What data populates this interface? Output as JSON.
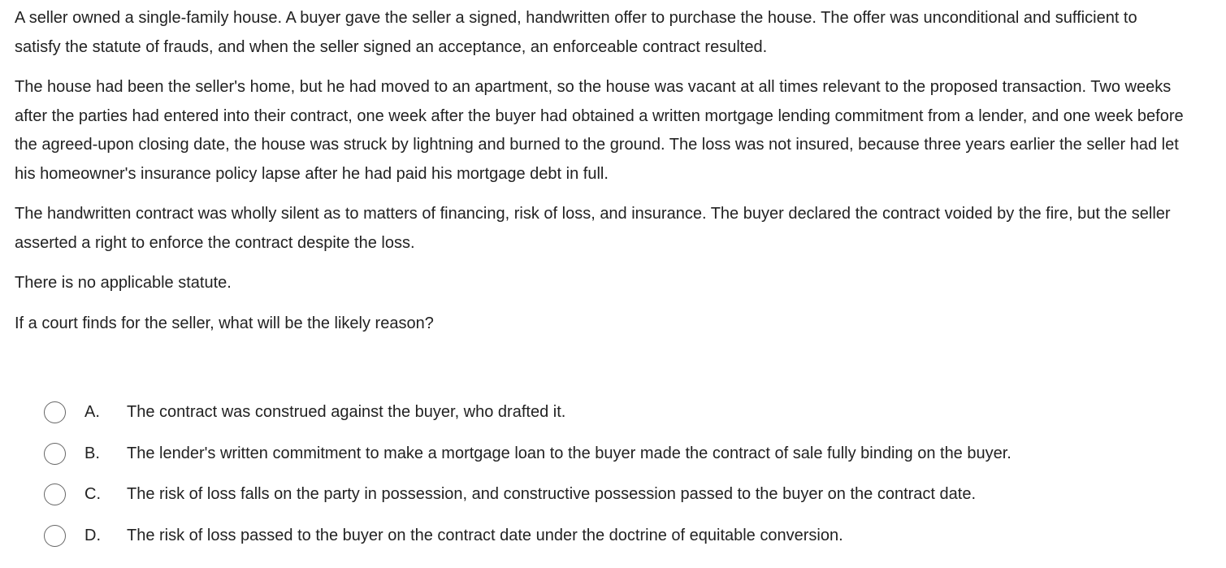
{
  "question": {
    "paragraphs": [
      "A seller owned a single-family house.  A buyer gave the seller a signed, handwritten offer to purchase the house.  The offer was unconditional and sufficient to satisfy the statute of frauds, and when the seller signed an acceptance, an enforceable contract resulted.",
      "The house had been the seller's home, but he had moved to an apartment, so the house was vacant at all times relevant to the proposed transaction.  Two weeks after the parties had entered into their contract, one week after the buyer had obtained a written mortgage lending commitment from a lender, and one week before the agreed-upon closing date, the house was struck by lightning and burned to the ground.  The loss was not insured, because three years earlier the seller had let his homeowner's insurance policy lapse after he had paid his mortgage debt in full.",
      "The handwritten contract was wholly silent as to matters of financing, risk of loss, and insurance.  The buyer declared the contract voided by the fire, but the seller asserted a right to enforce the contract despite the loss.",
      "There is no applicable statute.",
      "If a court finds for the seller, what will be the likely reason?"
    ]
  },
  "choices": [
    {
      "letter": "A.",
      "text": "The contract was construed against the buyer, who drafted it."
    },
    {
      "letter": "B.",
      "text": "The lender's written commitment to make a mortgage loan to the buyer made the contract of sale fully binding on the buyer."
    },
    {
      "letter": "C.",
      "text": "The risk of loss falls on the party in possession, and constructive possession passed to the buyer on the contract date."
    },
    {
      "letter": "D.",
      "text": "The risk of loss passed to the buyer on the contract date under the doctrine of equitable conversion."
    }
  ]
}
